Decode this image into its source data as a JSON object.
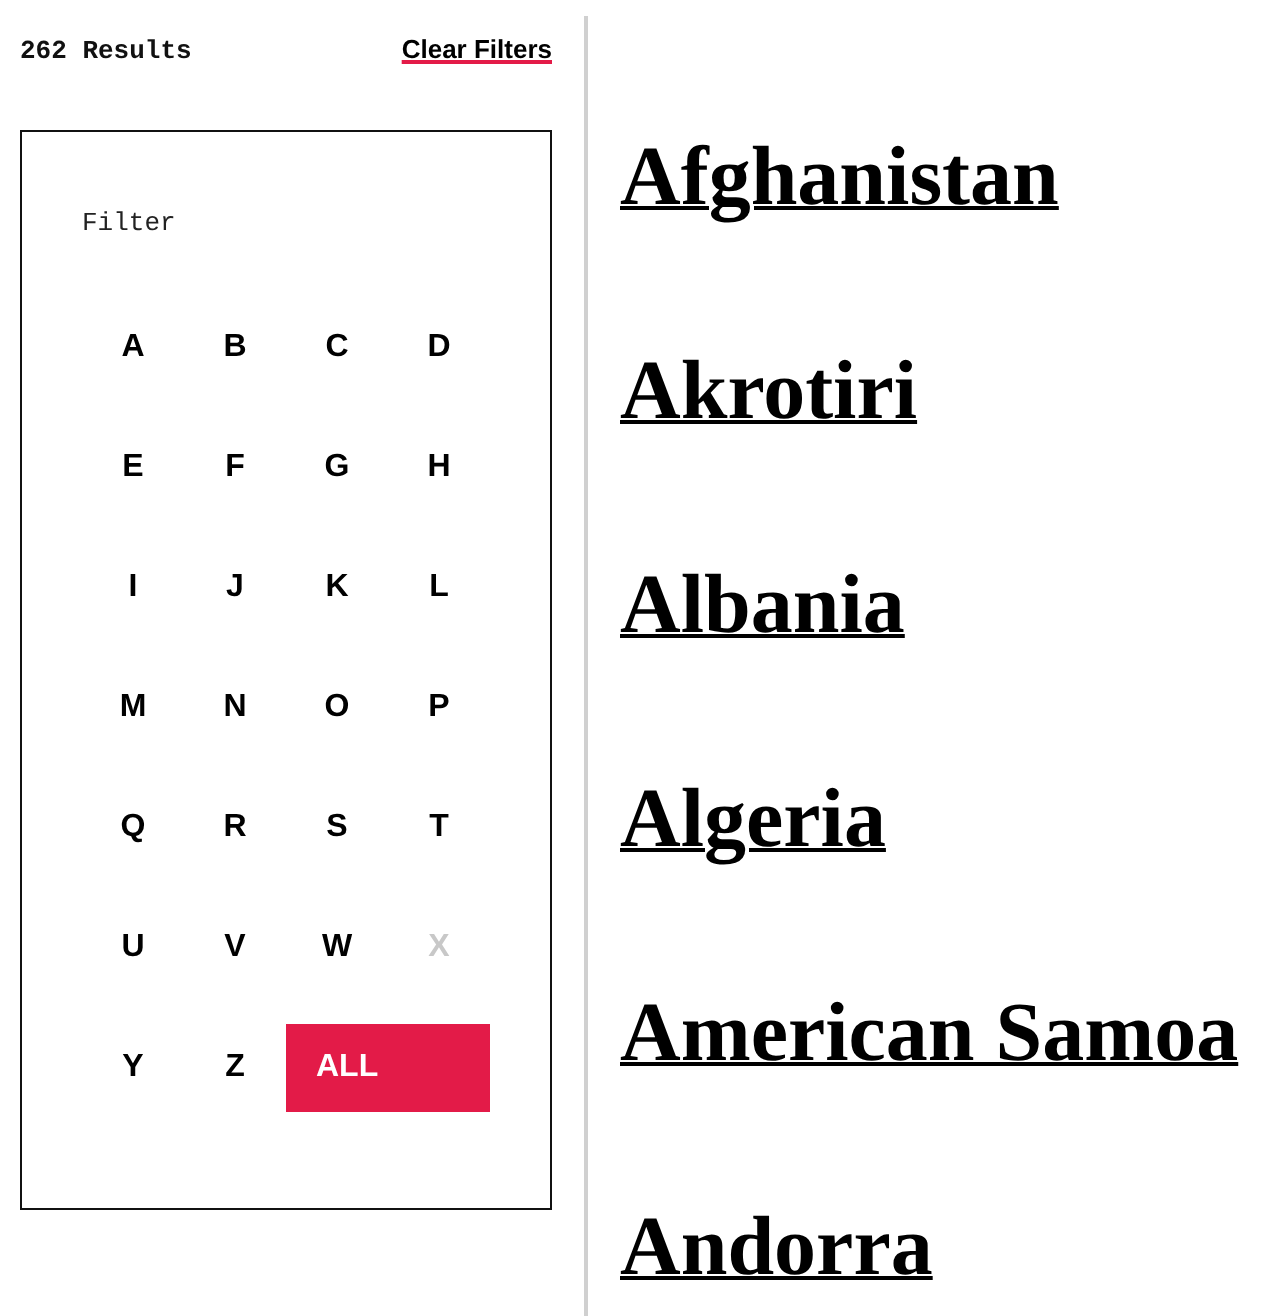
{
  "results_count": "262 Results",
  "clear_filters": "Clear Filters",
  "filter": {
    "title": "Filter",
    "letters": [
      {
        "label": "A",
        "disabled": false,
        "selected": false
      },
      {
        "label": "B",
        "disabled": false,
        "selected": false
      },
      {
        "label": "C",
        "disabled": false,
        "selected": false
      },
      {
        "label": "D",
        "disabled": false,
        "selected": false
      },
      {
        "label": "E",
        "disabled": false,
        "selected": false
      },
      {
        "label": "F",
        "disabled": false,
        "selected": false
      },
      {
        "label": "G",
        "disabled": false,
        "selected": false
      },
      {
        "label": "H",
        "disabled": false,
        "selected": false
      },
      {
        "label": "I",
        "disabled": false,
        "selected": false
      },
      {
        "label": "J",
        "disabled": false,
        "selected": false
      },
      {
        "label": "K",
        "disabled": false,
        "selected": false
      },
      {
        "label": "L",
        "disabled": false,
        "selected": false
      },
      {
        "label": "M",
        "disabled": false,
        "selected": false
      },
      {
        "label": "N",
        "disabled": false,
        "selected": false
      },
      {
        "label": "O",
        "disabled": false,
        "selected": false
      },
      {
        "label": "P",
        "disabled": false,
        "selected": false
      },
      {
        "label": "Q",
        "disabled": false,
        "selected": false
      },
      {
        "label": "R",
        "disabled": false,
        "selected": false
      },
      {
        "label": "S",
        "disabled": false,
        "selected": false
      },
      {
        "label": "T",
        "disabled": false,
        "selected": false
      },
      {
        "label": "U",
        "disabled": false,
        "selected": false
      },
      {
        "label": "V",
        "disabled": false,
        "selected": false
      },
      {
        "label": "W",
        "disabled": false,
        "selected": false
      },
      {
        "label": "X",
        "disabled": true,
        "selected": false
      },
      {
        "label": "Y",
        "disabled": false,
        "selected": false
      },
      {
        "label": "Z",
        "disabled": false,
        "selected": false
      },
      {
        "label": "ALL",
        "disabled": false,
        "selected": true
      }
    ]
  },
  "countries": [
    "Afghanistan",
    "Akrotiri",
    "Albania",
    "Algeria",
    "American Samoa",
    "Andorra"
  ]
}
